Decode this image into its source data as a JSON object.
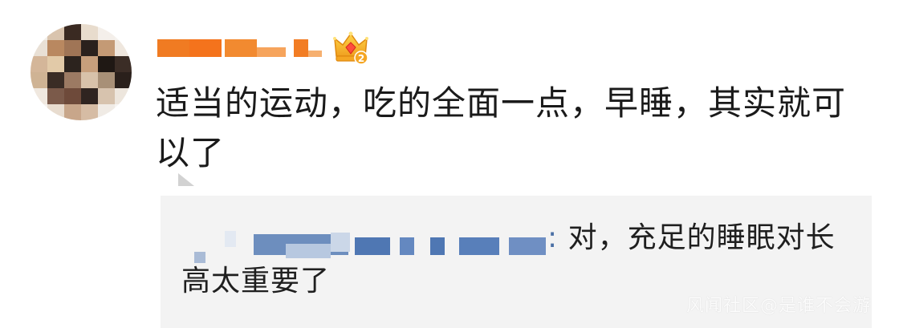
{
  "comment": {
    "author_avatar": "avatar-pixelated",
    "author_name_censored": true,
    "vip_icon": "crown-vip-icon",
    "vip_level": "2",
    "text": "适当的运动，吃的全面一点，早睡，其实就可以了"
  },
  "reply": {
    "author_name_censored": true,
    "colon": ":",
    "text": " 对，充足的睡眠对长高太重要了"
  },
  "watermark": {
    "text": "风闻社区@是谁不会游"
  },
  "colors": {
    "accent_orange": "#f07b22",
    "reply_blue": "#4a6fa5",
    "reply_bg": "#f3f3f3",
    "text": "#1a1a1a"
  }
}
